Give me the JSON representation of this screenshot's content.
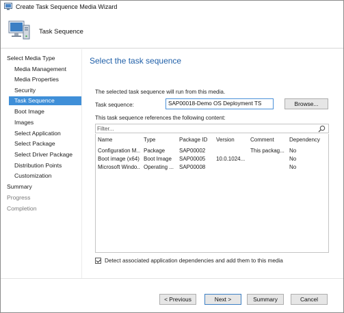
{
  "window": {
    "title": "Create Task Sequence Media Wizard"
  },
  "header": {
    "title": "Task Sequence"
  },
  "sidebar": {
    "items": [
      {
        "label": "Select Media Type",
        "level": "top",
        "state": "normal"
      },
      {
        "label": "Media Management",
        "level": "sub",
        "state": "normal"
      },
      {
        "label": "Media Properties",
        "level": "sub",
        "state": "normal"
      },
      {
        "label": "Security",
        "level": "sub",
        "state": "normal"
      },
      {
        "label": "Task Sequence",
        "level": "sub",
        "state": "active"
      },
      {
        "label": "Boot Image",
        "level": "sub",
        "state": "normal"
      },
      {
        "label": "Images",
        "level": "sub",
        "state": "normal"
      },
      {
        "label": "Select Application",
        "level": "sub",
        "state": "normal"
      },
      {
        "label": "Select Package",
        "level": "sub",
        "state": "normal"
      },
      {
        "label": "Select Driver Package",
        "level": "sub",
        "state": "normal"
      },
      {
        "label": "Distribution Points",
        "level": "sub",
        "state": "normal"
      },
      {
        "label": "Customization",
        "level": "sub",
        "state": "normal"
      },
      {
        "label": "Summary",
        "level": "top",
        "state": "normal"
      },
      {
        "label": "Progress",
        "level": "top",
        "state": "dim"
      },
      {
        "label": "Completion",
        "level": "top",
        "state": "dim"
      }
    ]
  },
  "main": {
    "page_title": "Select the task sequence",
    "description": "The selected task sequence will run from this media.",
    "ts_label": "Task sequence:",
    "ts_value": "SAP00018-Demo OS Deployment TS",
    "browse_label": "Browse...",
    "ref_label": "This task sequence references the following content:",
    "filter_placeholder": "Filter...",
    "table": {
      "columns": [
        "Name",
        "Type",
        "Package ID",
        "Version",
        "Comment",
        "Dependency"
      ],
      "rows": [
        [
          "Configuration M...",
          "Package",
          "SAP00002",
          "",
          "This packag...",
          "No"
        ],
        [
          "Boot image (x64)",
          "Boot Image",
          "SAP00005",
          "10.0.1024...",
          "",
          "No"
        ],
        [
          "Microsoft Windo...",
          "Operating ...",
          "SAP00008",
          "",
          "",
          "No"
        ]
      ]
    },
    "detect_label": "Detect associated application dependencies and add them to this media",
    "detect_checked": true
  },
  "footer": {
    "prev_label": "< Previous",
    "next_label": "Next >",
    "summary_label": "Summary",
    "cancel_label": "Cancel"
  },
  "colors": {
    "accent": "#3f8fd8",
    "title_blue": "#1f5fa8"
  }
}
